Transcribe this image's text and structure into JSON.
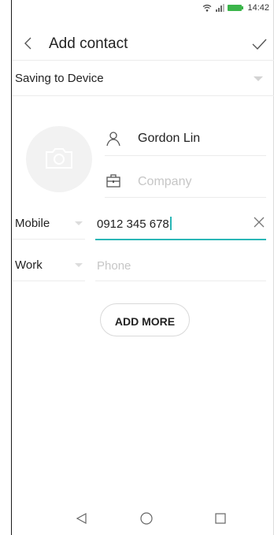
{
  "status_bar": {
    "time": "14:42"
  },
  "header": {
    "title": "Add contact"
  },
  "saving": {
    "label": "Saving to Device"
  },
  "contact": {
    "name": "Gordon Lin",
    "company_placeholder": "Company"
  },
  "phones": [
    {
      "label": "Mobile",
      "value": "0912 345 678"
    },
    {
      "label": "Work",
      "placeholder": "Phone"
    }
  ],
  "actions": {
    "add_more": "ADD MORE"
  },
  "colors": {
    "accent": "#2ab7b7",
    "battery": "#3bb54a"
  },
  "icons": [
    "back-arrow-icon",
    "checkmark-icon",
    "camera-icon",
    "person-icon",
    "briefcase-icon",
    "clear-icon",
    "wifi-icon",
    "signal-icon",
    "battery-icon",
    "nav-back-icon",
    "nav-home-icon",
    "nav-recents-icon"
  ]
}
